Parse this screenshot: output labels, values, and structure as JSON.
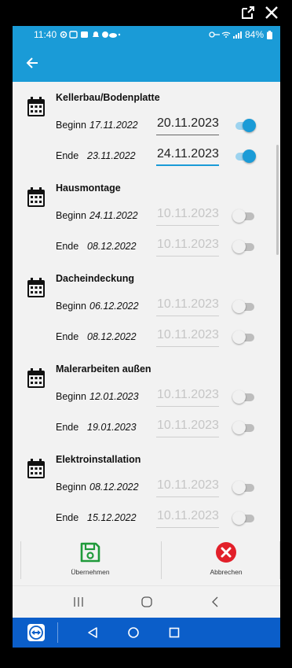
{
  "statusbar": {
    "time": "11:40",
    "battery": "84%"
  },
  "sections": [
    {
      "title": "Kellerbau/Bodenplatte",
      "rows": [
        {
          "label": "Beginn",
          "date": "17.11.2022",
          "value": "20.11.2023",
          "enabled": true
        },
        {
          "label": "Ende",
          "date": "23.11.2022",
          "value": "24.11.2023",
          "enabled": true
        }
      ]
    },
    {
      "title": "Hausmontage",
      "rows": [
        {
          "label": "Beginn",
          "date": "24.11.2022",
          "value": "10.11.2023",
          "enabled": false
        },
        {
          "label": "Ende",
          "date": "08.12.2022",
          "value": "10.11.2023",
          "enabled": false
        }
      ]
    },
    {
      "title": "Dacheindeckung",
      "rows": [
        {
          "label": "Beginn",
          "date": "06.12.2022",
          "value": "10.11.2023",
          "enabled": false
        },
        {
          "label": "Ende",
          "date": "08.12.2022",
          "value": "10.11.2023",
          "enabled": false
        }
      ]
    },
    {
      "title": "Malerarbeiten außen",
      "rows": [
        {
          "label": "Beginn",
          "date": "12.01.2023",
          "value": "10.11.2023",
          "enabled": false
        },
        {
          "label": "Ende",
          "date": "19.01.2023",
          "value": "10.11.2023",
          "enabled": false
        }
      ]
    },
    {
      "title": "Elektroinstallation",
      "rows": [
        {
          "label": "Beginn",
          "date": "08.12.2022",
          "value": "10.11.2023",
          "enabled": false
        },
        {
          "label": "Ende",
          "date": "15.12.2022",
          "value": "10.11.2023",
          "enabled": false
        }
      ]
    }
  ],
  "actions": {
    "save_label": "Übernehmen",
    "cancel_label": "Abbrechen"
  },
  "colors": {
    "accent": "#1a9bd7",
    "save": "#1f9a3a",
    "cancel": "#e2202a",
    "teamviewer": "#0b5ec9"
  }
}
